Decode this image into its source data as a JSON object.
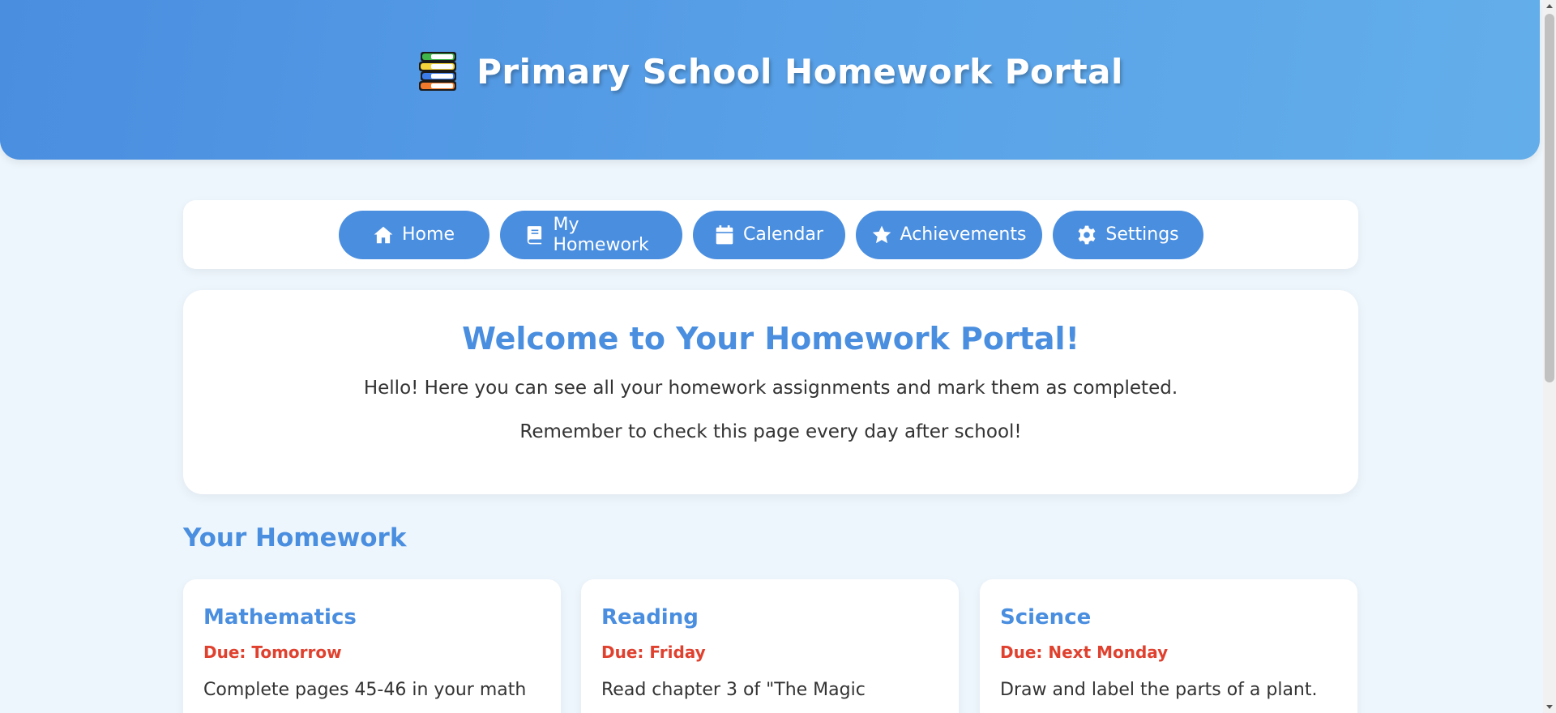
{
  "header": {
    "title": "Primary School Homework Portal",
    "icon": "books-icon"
  },
  "nav": {
    "items": [
      {
        "label": "Home",
        "icon": "home-icon"
      },
      {
        "label": "My Homework",
        "icon": "book-icon"
      },
      {
        "label": "Calendar",
        "icon": "calendar-icon"
      },
      {
        "label": "Achievements",
        "icon": "star-icon"
      },
      {
        "label": "Settings",
        "icon": "gear-icon"
      }
    ]
  },
  "welcome": {
    "title": "Welcome to Your Homework Portal!",
    "line1": "Hello! Here you can see all your homework assignments and mark them as completed.",
    "line2": "Remember to check this page every day after school!"
  },
  "homework": {
    "section_title": "Your Homework",
    "cards": [
      {
        "subject": "Mathematics",
        "due": "Due: Tomorrow",
        "description": "Complete pages 45-46 in your math"
      },
      {
        "subject": "Reading",
        "due": "Due: Friday",
        "description": "Read chapter 3 of \"The Magic"
      },
      {
        "subject": "Science",
        "due": "Due: Next Monday",
        "description": "Draw and label the parts of a plant."
      }
    ]
  },
  "colors": {
    "accent": "#4a8ee0",
    "due": "#e0412f",
    "background": "#eef6fd"
  }
}
